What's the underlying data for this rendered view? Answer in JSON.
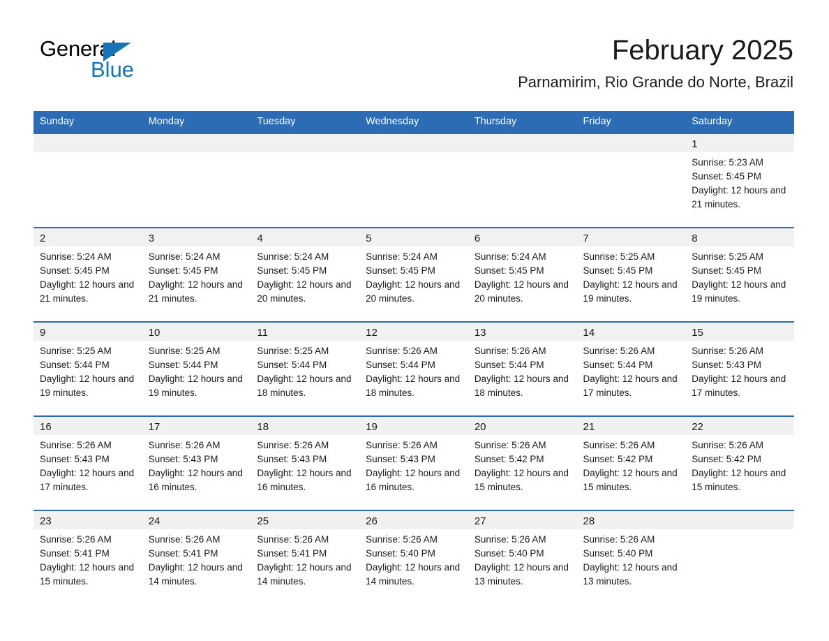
{
  "brand": {
    "name_part1": "General",
    "name_part2": "Blue",
    "accent_color": "#1573ba"
  },
  "header": {
    "title": "February 2025",
    "subtitle": "Parnamirim, Rio Grande do Norte, Brazil"
  },
  "theme": {
    "header_blue": "#2b6cb4",
    "daynum_band": "#f1f1f1",
    "text": "#1a1a1a"
  },
  "weekdays": [
    "Sunday",
    "Monday",
    "Tuesday",
    "Wednesday",
    "Thursday",
    "Friday",
    "Saturday"
  ],
  "weeks": [
    [
      {
        "day": "",
        "sunrise": "",
        "sunset": "",
        "daylight": ""
      },
      {
        "day": "",
        "sunrise": "",
        "sunset": "",
        "daylight": ""
      },
      {
        "day": "",
        "sunrise": "",
        "sunset": "",
        "daylight": ""
      },
      {
        "day": "",
        "sunrise": "",
        "sunset": "",
        "daylight": ""
      },
      {
        "day": "",
        "sunrise": "",
        "sunset": "",
        "daylight": ""
      },
      {
        "day": "",
        "sunrise": "",
        "sunset": "",
        "daylight": ""
      },
      {
        "day": "1",
        "sunrise": "Sunrise: 5:23 AM",
        "sunset": "Sunset: 5:45 PM",
        "daylight": "Daylight: 12 hours and 21 minutes."
      }
    ],
    [
      {
        "day": "2",
        "sunrise": "Sunrise: 5:24 AM",
        "sunset": "Sunset: 5:45 PM",
        "daylight": "Daylight: 12 hours and 21 minutes."
      },
      {
        "day": "3",
        "sunrise": "Sunrise: 5:24 AM",
        "sunset": "Sunset: 5:45 PM",
        "daylight": "Daylight: 12 hours and 21 minutes."
      },
      {
        "day": "4",
        "sunrise": "Sunrise: 5:24 AM",
        "sunset": "Sunset: 5:45 PM",
        "daylight": "Daylight: 12 hours and 20 minutes."
      },
      {
        "day": "5",
        "sunrise": "Sunrise: 5:24 AM",
        "sunset": "Sunset: 5:45 PM",
        "daylight": "Daylight: 12 hours and 20 minutes."
      },
      {
        "day": "6",
        "sunrise": "Sunrise: 5:24 AM",
        "sunset": "Sunset: 5:45 PM",
        "daylight": "Daylight: 12 hours and 20 minutes."
      },
      {
        "day": "7",
        "sunrise": "Sunrise: 5:25 AM",
        "sunset": "Sunset: 5:45 PM",
        "daylight": "Daylight: 12 hours and 19 minutes."
      },
      {
        "day": "8",
        "sunrise": "Sunrise: 5:25 AM",
        "sunset": "Sunset: 5:45 PM",
        "daylight": "Daylight: 12 hours and 19 minutes."
      }
    ],
    [
      {
        "day": "9",
        "sunrise": "Sunrise: 5:25 AM",
        "sunset": "Sunset: 5:44 PM",
        "daylight": "Daylight: 12 hours and 19 minutes."
      },
      {
        "day": "10",
        "sunrise": "Sunrise: 5:25 AM",
        "sunset": "Sunset: 5:44 PM",
        "daylight": "Daylight: 12 hours and 19 minutes."
      },
      {
        "day": "11",
        "sunrise": "Sunrise: 5:25 AM",
        "sunset": "Sunset: 5:44 PM",
        "daylight": "Daylight: 12 hours and 18 minutes."
      },
      {
        "day": "12",
        "sunrise": "Sunrise: 5:26 AM",
        "sunset": "Sunset: 5:44 PM",
        "daylight": "Daylight: 12 hours and 18 minutes."
      },
      {
        "day": "13",
        "sunrise": "Sunrise: 5:26 AM",
        "sunset": "Sunset: 5:44 PM",
        "daylight": "Daylight: 12 hours and 18 minutes."
      },
      {
        "day": "14",
        "sunrise": "Sunrise: 5:26 AM",
        "sunset": "Sunset: 5:44 PM",
        "daylight": "Daylight: 12 hours and 17 minutes."
      },
      {
        "day": "15",
        "sunrise": "Sunrise: 5:26 AM",
        "sunset": "Sunset: 5:43 PM",
        "daylight": "Daylight: 12 hours and 17 minutes."
      }
    ],
    [
      {
        "day": "16",
        "sunrise": "Sunrise: 5:26 AM",
        "sunset": "Sunset: 5:43 PM",
        "daylight": "Daylight: 12 hours and 17 minutes."
      },
      {
        "day": "17",
        "sunrise": "Sunrise: 5:26 AM",
        "sunset": "Sunset: 5:43 PM",
        "daylight": "Daylight: 12 hours and 16 minutes."
      },
      {
        "day": "18",
        "sunrise": "Sunrise: 5:26 AM",
        "sunset": "Sunset: 5:43 PM",
        "daylight": "Daylight: 12 hours and 16 minutes."
      },
      {
        "day": "19",
        "sunrise": "Sunrise: 5:26 AM",
        "sunset": "Sunset: 5:43 PM",
        "daylight": "Daylight: 12 hours and 16 minutes."
      },
      {
        "day": "20",
        "sunrise": "Sunrise: 5:26 AM",
        "sunset": "Sunset: 5:42 PM",
        "daylight": "Daylight: 12 hours and 15 minutes."
      },
      {
        "day": "21",
        "sunrise": "Sunrise: 5:26 AM",
        "sunset": "Sunset: 5:42 PM",
        "daylight": "Daylight: 12 hours and 15 minutes."
      },
      {
        "day": "22",
        "sunrise": "Sunrise: 5:26 AM",
        "sunset": "Sunset: 5:42 PM",
        "daylight": "Daylight: 12 hours and 15 minutes."
      }
    ],
    [
      {
        "day": "23",
        "sunrise": "Sunrise: 5:26 AM",
        "sunset": "Sunset: 5:41 PM",
        "daylight": "Daylight: 12 hours and 15 minutes."
      },
      {
        "day": "24",
        "sunrise": "Sunrise: 5:26 AM",
        "sunset": "Sunset: 5:41 PM",
        "daylight": "Daylight: 12 hours and 14 minutes."
      },
      {
        "day": "25",
        "sunrise": "Sunrise: 5:26 AM",
        "sunset": "Sunset: 5:41 PM",
        "daylight": "Daylight: 12 hours and 14 minutes."
      },
      {
        "day": "26",
        "sunrise": "Sunrise: 5:26 AM",
        "sunset": "Sunset: 5:40 PM",
        "daylight": "Daylight: 12 hours and 14 minutes."
      },
      {
        "day": "27",
        "sunrise": "Sunrise: 5:26 AM",
        "sunset": "Sunset: 5:40 PM",
        "daylight": "Daylight: 12 hours and 13 minutes."
      },
      {
        "day": "28",
        "sunrise": "Sunrise: 5:26 AM",
        "sunset": "Sunset: 5:40 PM",
        "daylight": "Daylight: 12 hours and 13 minutes."
      },
      {
        "day": "",
        "sunrise": "",
        "sunset": "",
        "daylight": ""
      }
    ]
  ]
}
